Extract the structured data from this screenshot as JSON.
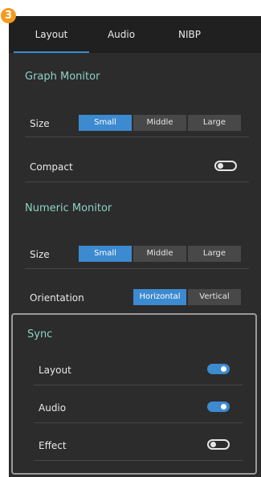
{
  "badge": {
    "number": "3"
  },
  "tabs": [
    {
      "label": "Layout",
      "active": true
    },
    {
      "label": "Audio",
      "active": false
    },
    {
      "label": "NIBP",
      "active": false
    }
  ],
  "graph_monitor": {
    "title": "Graph Monitor",
    "size_label": "Size",
    "size_options": [
      "Small",
      "Middle",
      "Large"
    ],
    "size_selected": "Small",
    "compact_label": "Compact",
    "compact_on": false
  },
  "numeric_monitor": {
    "title": "Numeric Monitor",
    "size_label": "Size",
    "size_options": [
      "Small",
      "Middle",
      "Large"
    ],
    "size_selected": "Small",
    "orientation_label": "Orientation",
    "orientation_options": [
      "Horizontal",
      "Vertical"
    ],
    "orientation_selected": "Horizontal"
  },
  "sync": {
    "title": "Sync",
    "layout_label": "Layout",
    "layout_on": true,
    "audio_label": "Audio",
    "audio_on": true,
    "effect_label": "Effect",
    "effect_on": false
  },
  "colors": {
    "accent": "#3c8ad0",
    "section_title": "#8fd2c2",
    "panel_bg": "#2c2c2c",
    "tab_bar_bg": "#202020",
    "badge": "#f39a1f"
  }
}
